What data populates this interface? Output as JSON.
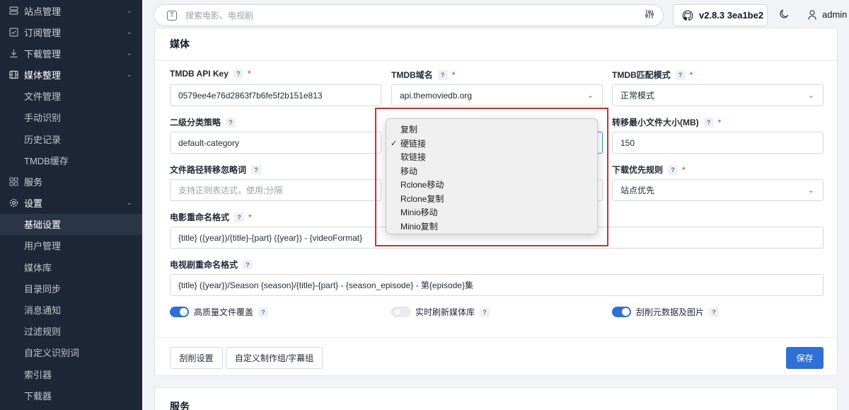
{
  "sidebar": {
    "items": [
      {
        "label": "站点管理",
        "icon": "server-icon",
        "chevron": "⌄"
      },
      {
        "label": "订阅管理",
        "icon": "checkbox-icon",
        "chevron": "⌄"
      },
      {
        "label": "下载管理",
        "icon": "download-icon",
        "chevron": "⌄"
      },
      {
        "label": "媒体整理",
        "icon": "film-icon",
        "chevron": "⌄"
      },
      {
        "label": "文件管理"
      },
      {
        "label": "手动识别"
      },
      {
        "label": "历史记录"
      },
      {
        "label": "TMDB缓存"
      },
      {
        "label": "服务",
        "icon": "grid-icon"
      },
      {
        "label": "设置",
        "icon": "gear-icon",
        "chevron": "⌄"
      },
      {
        "label": "基础设置"
      },
      {
        "label": "用户管理"
      },
      {
        "label": "媒体库"
      },
      {
        "label": "目录同步"
      },
      {
        "label": "消息通知"
      },
      {
        "label": "过滤规则"
      },
      {
        "label": "自定义识别词"
      },
      {
        "label": "索引器"
      },
      {
        "label": "下载器"
      }
    ]
  },
  "header": {
    "search_placeholder": "搜索电影、电视剧",
    "search_key": "T",
    "version": "v2.8.3 3ea1be2",
    "user": "admin"
  },
  "media": {
    "title": "媒体",
    "help": "?",
    "req": "*",
    "tmdb_api_key_label": "TMDB API Key",
    "tmdb_api_key_value": "0579ee4e76d2863f7b6fe5f2b151e813",
    "tmdb_domain_label": "TMDB域名",
    "tmdb_domain_value": "api.themoviedb.org",
    "tmdb_match_label": "TMDB匹配模式",
    "tmdb_match_value": "正常模式",
    "category_label": "二级分类策略",
    "category_value": "default-category",
    "min_size_label": "转移最小文件大小(MB)",
    "min_size_value": "150",
    "ignore_label": "文件路径转移忽略词",
    "ignore_placeholder": "支持正则表达式，使用;分隔",
    "download_priority_label": "下载优先规则",
    "download_priority_value": "站点优先",
    "movie_format_label": "电影重命名格式",
    "movie_format_value": "{title} ({year})/{title}-{part} ({year}) - {videoFormat}",
    "tv_format_label": "电视剧重命名格式",
    "tv_format_value": "{title} ({year})/Season {season}/{title}-{part} - {season_episode} - 第{episode}集",
    "switch_overwrite": "高质量文件覆盖",
    "switch_refresh": "实时刷新媒体库",
    "switch_scrape": "刮削元数据及图片",
    "btn_scrape": "刮削设置",
    "btn_release": "自定义制作组/字幕组",
    "btn_save": "保存"
  },
  "transfer_dropdown": {
    "selected": "硬链接",
    "options": [
      "复制",
      "硬链接",
      "软链接",
      "移动",
      "Rclone移动",
      "Rclone复制",
      "Minio移动",
      "Minio复制"
    ]
  },
  "service": {
    "title": "服务"
  },
  "colors": {
    "sidebar_bg": "#1e2738",
    "primary": "#2f6fd6",
    "highlight": "#d62b2b"
  }
}
